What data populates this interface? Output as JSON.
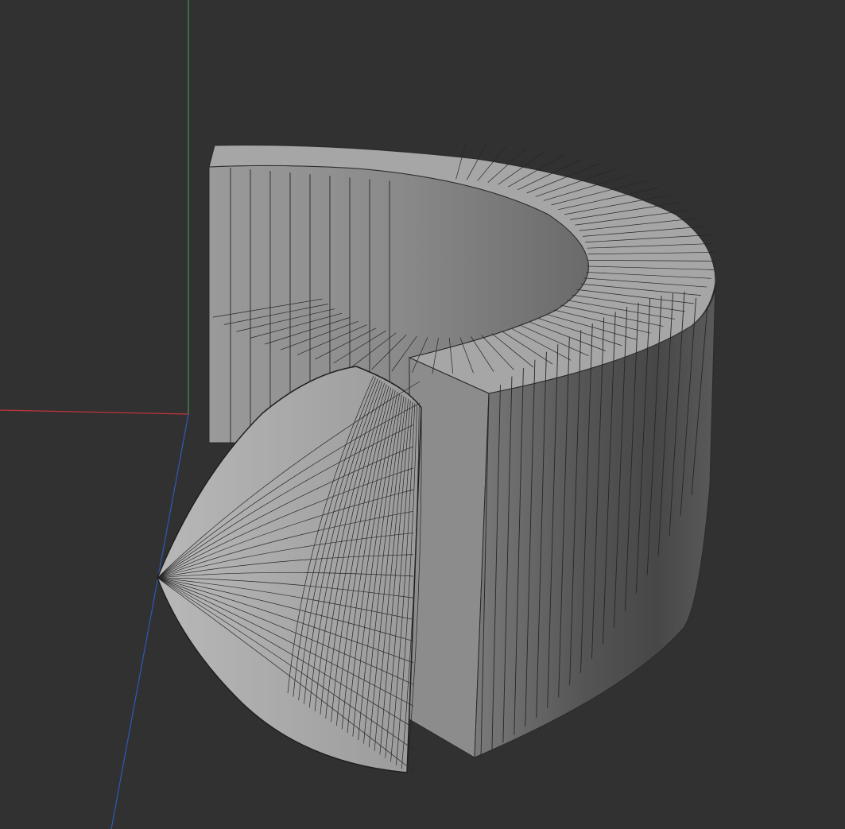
{
  "scene": {
    "background_color": "#313131",
    "axes": {
      "x_color": "#c8343c",
      "y_color": "#3a9a4a",
      "z_color": "#2e59b8"
    },
    "objects": [
      {
        "name": "partial-ring",
        "kind": "extruded ring segment",
        "color": "#8f8f8f"
      },
      {
        "name": "paraboloid-segment",
        "kind": "curved wedge mesh",
        "color": "#9c9c9c"
      }
    ]
  }
}
